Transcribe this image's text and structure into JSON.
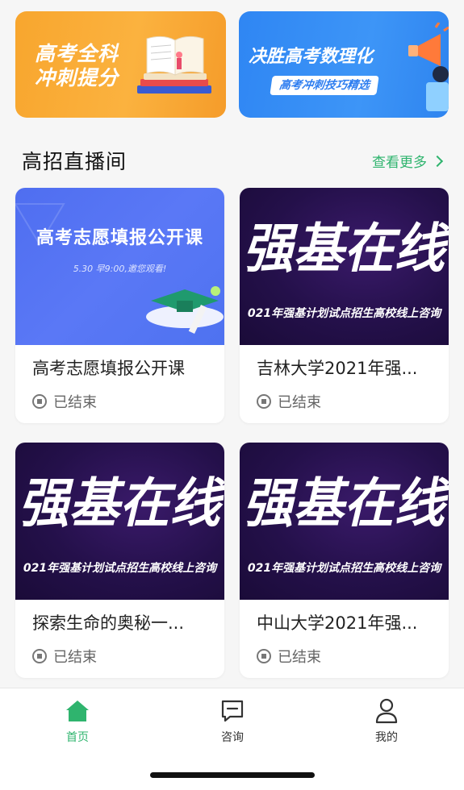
{
  "banners": [
    {
      "line1": "高考全科",
      "line2": "冲刺提分"
    },
    {
      "title": "决胜高考数理化",
      "subtitle": "高考冲刺技巧精选"
    }
  ],
  "section": {
    "title": "高招直播间",
    "more_label": "查看更多"
  },
  "cards": [
    {
      "thumb_title": "高考志愿填报公开课",
      "thumb_note": "5.30 早9:00,邀您观看!",
      "title": "高考志愿填报公开课",
      "status": "已结束"
    },
    {
      "thumb_big": "强基在线",
      "thumb_bar": "021年强基计划试点招生高校线上咨询",
      "title": "吉林大学2021年强...",
      "status": "已结束"
    },
    {
      "thumb_big": "强基在线",
      "thumb_bar": "021年强基计划试点招生高校线上咨询",
      "title": "探索生命的奥秘一...",
      "status": "已结束"
    },
    {
      "thumb_big": "强基在线",
      "thumb_bar": "021年强基计划试点招生高校线上咨询",
      "title": "中山大学2021年强...",
      "status": "已结束"
    }
  ],
  "tabbar": [
    {
      "label": "首页",
      "icon": "home-icon",
      "active": true
    },
    {
      "label": "咨询",
      "icon": "message-icon",
      "active": false
    },
    {
      "label": "我的",
      "icon": "user-icon",
      "active": false
    }
  ],
  "colors": {
    "accent": "#2fb46e",
    "orange": "#f8a62e",
    "blue": "#2f86f3",
    "purple": "#24104a"
  }
}
